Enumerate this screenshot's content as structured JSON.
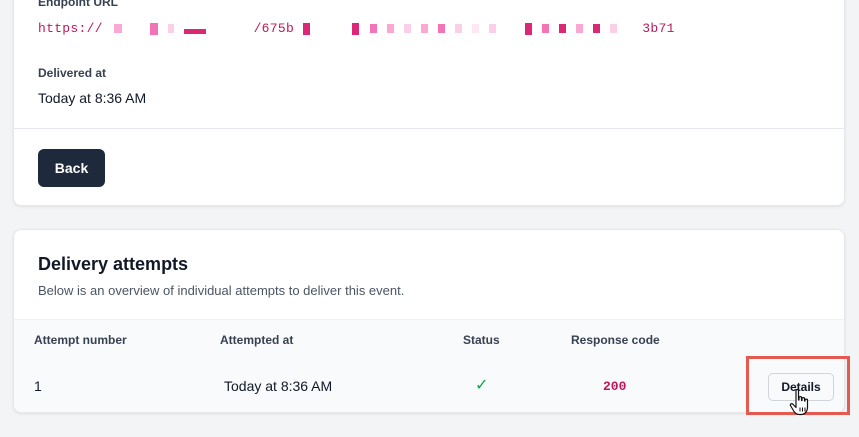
{
  "event": {
    "endpoint_label": "Endpoint URL",
    "endpoint_url_start": "https://",
    "endpoint_url_mid": "/675b",
    "endpoint_url_end": "3b71",
    "delivered_label": "Delivered at",
    "delivered_value": "Today at 8:36 AM",
    "back_label": "Back"
  },
  "attempts": {
    "title": "Delivery attempts",
    "subtitle": "Below is an overview of individual attempts to deliver this event.",
    "columns": {
      "attempt_number": "Attempt number",
      "attempted_at": "Attempted at",
      "status": "Status",
      "response_code": "Response code"
    },
    "rows": [
      {
        "attempt_number": "1",
        "attempted_at": "Today at 8:36 AM",
        "status_icon": "✓",
        "response_code": "200",
        "details_label": "Details"
      }
    ]
  },
  "colors": {
    "accent_pink": "#be185d",
    "button_dark": "#1e293b",
    "success_green": "#16a34a",
    "highlight_red": "#e55a4e"
  }
}
